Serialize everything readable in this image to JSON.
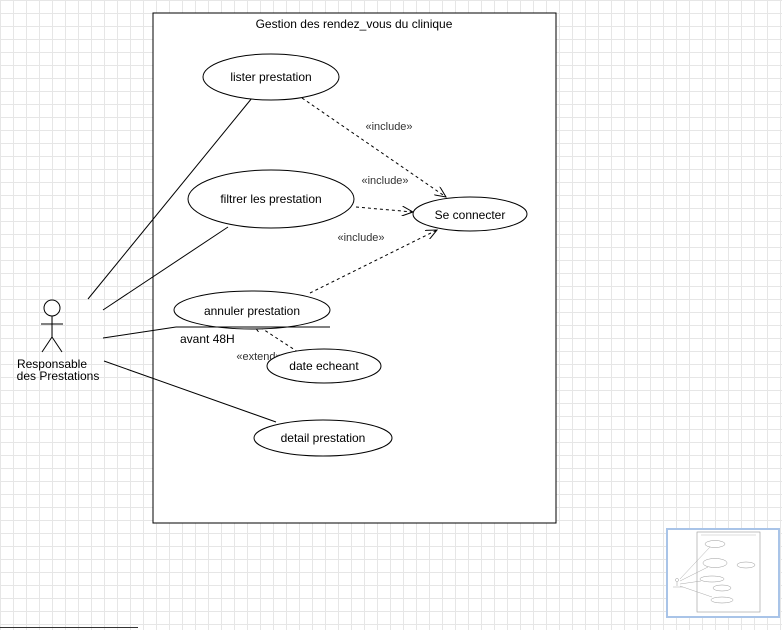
{
  "system": {
    "title": "Gestion des rendez_vous du clinique"
  },
  "actor": {
    "line1": "Responsable",
    "line2": "des Prestations"
  },
  "use_cases": {
    "lister": "lister prestation",
    "filtrer": "filtrer les prestation",
    "connecter": "Se connecter",
    "annuler": "annuler prestation",
    "date": "date echeant",
    "detail": "detail prestation"
  },
  "relations": {
    "include1": "«include»",
    "include2": "«include»",
    "include3": "«include»",
    "extend": "«extend»"
  },
  "constraint": "avant 48H",
  "colors": {
    "stroke": "#000000",
    "grid": "#e6e6e6",
    "minimap_border": "#a9c4e8"
  }
}
